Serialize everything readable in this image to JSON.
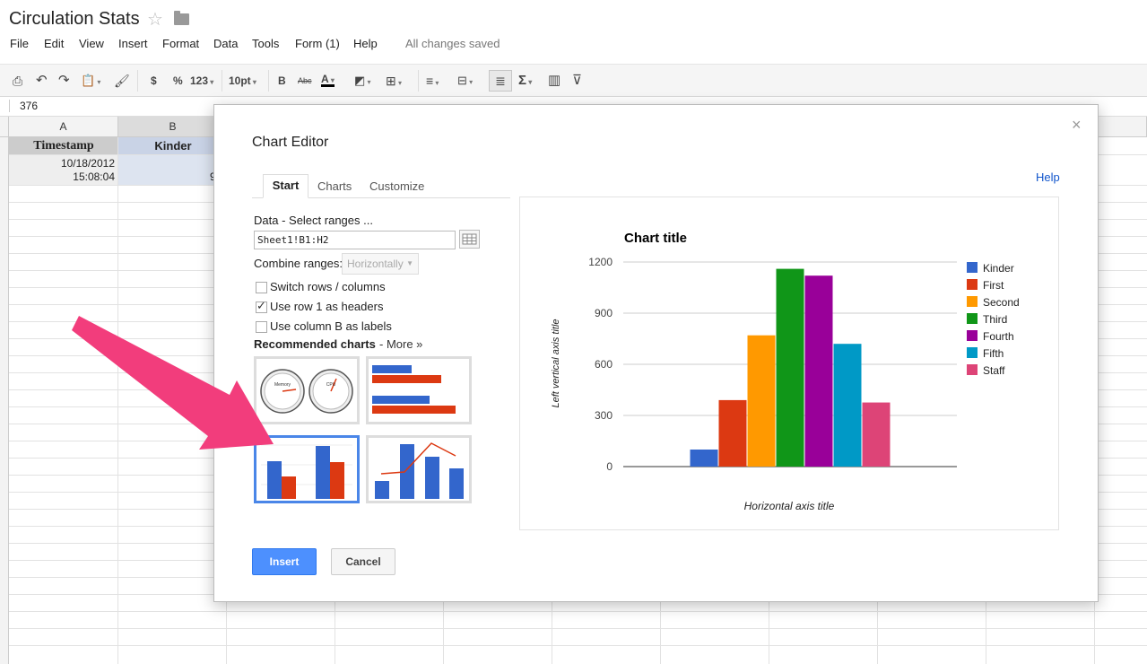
{
  "document": {
    "title": "Circulation Stats",
    "save_status": "All changes saved"
  },
  "menu": [
    "File",
    "Edit",
    "View",
    "Insert",
    "Format",
    "Data",
    "Tools",
    "Form (1)",
    "Help"
  ],
  "toolbar": {
    "currency": "$",
    "percent": "%",
    "number_format": "123",
    "font_size": "10pt",
    "bold": "B",
    "strikethrough": "Abc",
    "text_color": "A",
    "sum": "Σ"
  },
  "formula_bar": {
    "value": "376"
  },
  "sheet": {
    "columns": [
      "A",
      "B"
    ],
    "header_row": [
      "Timestamp",
      "Kinder"
    ],
    "data_row": {
      "timestamp_date": "10/18/2012",
      "timestamp_time": "15:08:04",
      "b_partial": "9"
    }
  },
  "dialog": {
    "title": "Chart Editor",
    "close": "×",
    "help": "Help",
    "tabs": [
      "Start",
      "Charts",
      "Customize"
    ],
    "data_label": "Data",
    "select_ranges": " - Select ranges ...",
    "range_value": "Sheet1!B1:H2",
    "combine_label": "Combine ranges:",
    "combine_value": "Horizontally",
    "options": [
      {
        "label": "Switch rows / columns",
        "checked": false
      },
      {
        "label": "Use row 1 as headers",
        "checked": true
      },
      {
        "label": "Use column B as labels",
        "checked": false
      }
    ],
    "recommended_label": "Recommended charts",
    "more_link": " - More »",
    "gauge_labels": [
      "Memory",
      "CPU"
    ],
    "insert": "Insert",
    "cancel": "Cancel"
  },
  "chart_data": {
    "type": "bar",
    "title": "Chart title",
    "xlabel": "Horizontal axis title",
    "ylabel": "Left vertical axis title",
    "ylim": [
      0,
      1200
    ],
    "yticks": [
      "0",
      "300",
      "600",
      "900",
      "1200"
    ],
    "legend_position": "right",
    "series": [
      {
        "name": "Kinder",
        "value": 100,
        "color": "#3366cc"
      },
      {
        "name": "First",
        "value": 390,
        "color": "#dc3912"
      },
      {
        "name": "Second",
        "value": 770,
        "color": "#ff9900"
      },
      {
        "name": "Third",
        "value": 1160,
        "color": "#109618"
      },
      {
        "name": "Fourth",
        "value": 1120,
        "color": "#990099"
      },
      {
        "name": "Fifth",
        "value": 720,
        "color": "#0099c6"
      },
      {
        "name": "Staff",
        "value": 376,
        "color": "#dd4477"
      }
    ]
  },
  "colors": {
    "accent": "#4d90fe",
    "arrow": "#f23d7c",
    "link": "#1155cc"
  }
}
